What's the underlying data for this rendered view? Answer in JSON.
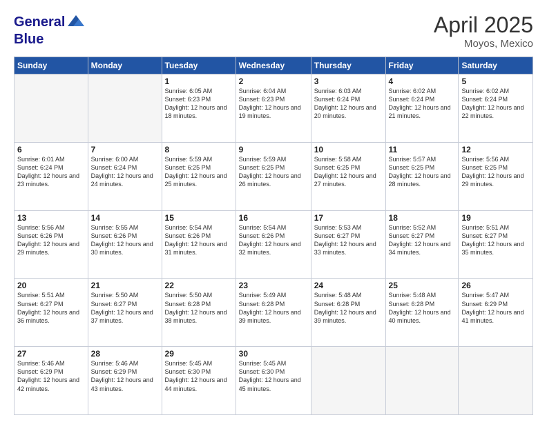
{
  "logo": {
    "line1": "General",
    "line2": "Blue"
  },
  "title": "April 2025",
  "location": "Moyos, Mexico",
  "header_days": [
    "Sunday",
    "Monday",
    "Tuesday",
    "Wednesday",
    "Thursday",
    "Friday",
    "Saturday"
  ],
  "weeks": [
    [
      {
        "day": "",
        "info": ""
      },
      {
        "day": "",
        "info": ""
      },
      {
        "day": "1",
        "info": "Sunrise: 6:05 AM\nSunset: 6:23 PM\nDaylight: 12 hours and 18 minutes."
      },
      {
        "day": "2",
        "info": "Sunrise: 6:04 AM\nSunset: 6:23 PM\nDaylight: 12 hours and 19 minutes."
      },
      {
        "day": "3",
        "info": "Sunrise: 6:03 AM\nSunset: 6:24 PM\nDaylight: 12 hours and 20 minutes."
      },
      {
        "day": "4",
        "info": "Sunrise: 6:02 AM\nSunset: 6:24 PM\nDaylight: 12 hours and 21 minutes."
      },
      {
        "day": "5",
        "info": "Sunrise: 6:02 AM\nSunset: 6:24 PM\nDaylight: 12 hours and 22 minutes."
      }
    ],
    [
      {
        "day": "6",
        "info": "Sunrise: 6:01 AM\nSunset: 6:24 PM\nDaylight: 12 hours and 23 minutes."
      },
      {
        "day": "7",
        "info": "Sunrise: 6:00 AM\nSunset: 6:24 PM\nDaylight: 12 hours and 24 minutes."
      },
      {
        "day": "8",
        "info": "Sunrise: 5:59 AM\nSunset: 6:25 PM\nDaylight: 12 hours and 25 minutes."
      },
      {
        "day": "9",
        "info": "Sunrise: 5:59 AM\nSunset: 6:25 PM\nDaylight: 12 hours and 26 minutes."
      },
      {
        "day": "10",
        "info": "Sunrise: 5:58 AM\nSunset: 6:25 PM\nDaylight: 12 hours and 27 minutes."
      },
      {
        "day": "11",
        "info": "Sunrise: 5:57 AM\nSunset: 6:25 PM\nDaylight: 12 hours and 28 minutes."
      },
      {
        "day": "12",
        "info": "Sunrise: 5:56 AM\nSunset: 6:25 PM\nDaylight: 12 hours and 29 minutes."
      }
    ],
    [
      {
        "day": "13",
        "info": "Sunrise: 5:56 AM\nSunset: 6:26 PM\nDaylight: 12 hours and 29 minutes."
      },
      {
        "day": "14",
        "info": "Sunrise: 5:55 AM\nSunset: 6:26 PM\nDaylight: 12 hours and 30 minutes."
      },
      {
        "day": "15",
        "info": "Sunrise: 5:54 AM\nSunset: 6:26 PM\nDaylight: 12 hours and 31 minutes."
      },
      {
        "day": "16",
        "info": "Sunrise: 5:54 AM\nSunset: 6:26 PM\nDaylight: 12 hours and 32 minutes."
      },
      {
        "day": "17",
        "info": "Sunrise: 5:53 AM\nSunset: 6:27 PM\nDaylight: 12 hours and 33 minutes."
      },
      {
        "day": "18",
        "info": "Sunrise: 5:52 AM\nSunset: 6:27 PM\nDaylight: 12 hours and 34 minutes."
      },
      {
        "day": "19",
        "info": "Sunrise: 5:51 AM\nSunset: 6:27 PM\nDaylight: 12 hours and 35 minutes."
      }
    ],
    [
      {
        "day": "20",
        "info": "Sunrise: 5:51 AM\nSunset: 6:27 PM\nDaylight: 12 hours and 36 minutes."
      },
      {
        "day": "21",
        "info": "Sunrise: 5:50 AM\nSunset: 6:27 PM\nDaylight: 12 hours and 37 minutes."
      },
      {
        "day": "22",
        "info": "Sunrise: 5:50 AM\nSunset: 6:28 PM\nDaylight: 12 hours and 38 minutes."
      },
      {
        "day": "23",
        "info": "Sunrise: 5:49 AM\nSunset: 6:28 PM\nDaylight: 12 hours and 39 minutes."
      },
      {
        "day": "24",
        "info": "Sunrise: 5:48 AM\nSunset: 6:28 PM\nDaylight: 12 hours and 39 minutes."
      },
      {
        "day": "25",
        "info": "Sunrise: 5:48 AM\nSunset: 6:28 PM\nDaylight: 12 hours and 40 minutes."
      },
      {
        "day": "26",
        "info": "Sunrise: 5:47 AM\nSunset: 6:29 PM\nDaylight: 12 hours and 41 minutes."
      }
    ],
    [
      {
        "day": "27",
        "info": "Sunrise: 5:46 AM\nSunset: 6:29 PM\nDaylight: 12 hours and 42 minutes."
      },
      {
        "day": "28",
        "info": "Sunrise: 5:46 AM\nSunset: 6:29 PM\nDaylight: 12 hours and 43 minutes."
      },
      {
        "day": "29",
        "info": "Sunrise: 5:45 AM\nSunset: 6:30 PM\nDaylight: 12 hours and 44 minutes."
      },
      {
        "day": "30",
        "info": "Sunrise: 5:45 AM\nSunset: 6:30 PM\nDaylight: 12 hours and 45 minutes."
      },
      {
        "day": "",
        "info": ""
      },
      {
        "day": "",
        "info": ""
      },
      {
        "day": "",
        "info": ""
      }
    ]
  ]
}
